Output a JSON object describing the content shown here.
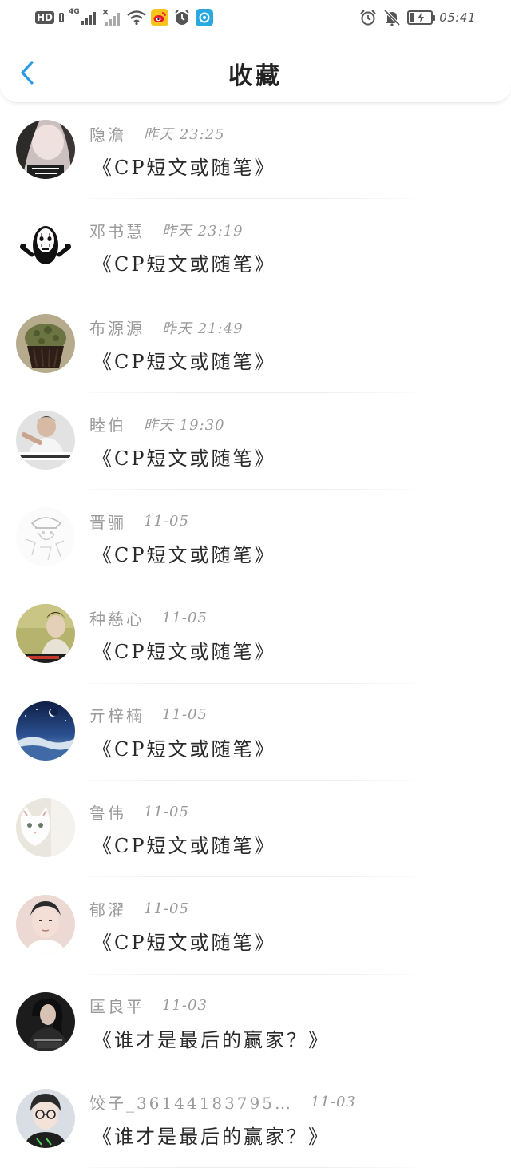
{
  "status_bar": {
    "hd_label": "HD",
    "network_label": "4G",
    "time": "05:41",
    "icons": [
      "hd-icon",
      "signal-icon",
      "signal-disabled-icon",
      "wifi-icon",
      "weibo-icon",
      "alarm-app-icon",
      "blue-app-icon",
      "alarm-icon",
      "mute-icon",
      "battery-charging-icon"
    ]
  },
  "header": {
    "title": "收藏",
    "back_icon": "chevron-left-icon",
    "accent_color": "#2b9be6"
  },
  "items": [
    {
      "name": "隐澹",
      "time": "昨天 23:25",
      "title": "《CP短文或随笔》",
      "avatar_color": "#b8a8a8"
    },
    {
      "name": "邓书慧",
      "time": "昨天 23:19",
      "title": "《CP短文或随笔》",
      "avatar_color": "#ffffff"
    },
    {
      "name": "布源源",
      "time": "昨天 21:49",
      "title": "《CP短文或随笔》",
      "avatar_color": "#6b6a3a"
    },
    {
      "name": "睦伯",
      "time": "昨天 19:30",
      "title": "《CP短文或随笔》",
      "avatar_color": "#d8d8d8"
    },
    {
      "name": "晋骊",
      "time": "11-05",
      "title": "《CP短文或随笔》",
      "avatar_color": "#f4f4f4"
    },
    {
      "name": "种慈心",
      "time": "11-05",
      "title": "《CP短文或随笔》",
      "avatar_color": "#b9b56c"
    },
    {
      "name": "亓梓楠",
      "time": "11-05",
      "title": "《CP短文或随笔》",
      "avatar_color": "#2e4e86"
    },
    {
      "name": "鲁伟",
      "time": "11-05",
      "title": "《CP短文或随笔》",
      "avatar_color": "#e8e4dc"
    },
    {
      "name": "郁濯",
      "time": "11-05",
      "title": "《CP短文或随笔》",
      "avatar_color": "#e6cdc6"
    },
    {
      "name": "匡良平",
      "time": "11-03",
      "title": "《谁才是最后的赢家？》",
      "avatar_color": "#1e1e1e"
    },
    {
      "name": "饺子_36144183795…",
      "time": "11-03",
      "title": "《谁才是最后的赢家？》",
      "avatar_color": "#cfd6dc"
    }
  ]
}
